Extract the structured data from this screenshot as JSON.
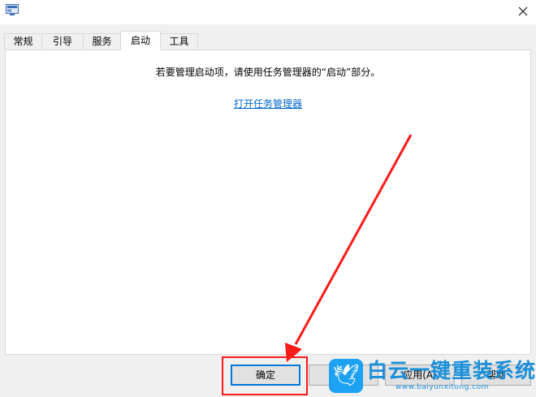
{
  "dialog": {
    "tabs": [
      {
        "label": "常规"
      },
      {
        "label": "引导"
      },
      {
        "label": "服务"
      },
      {
        "label": "启动"
      },
      {
        "label": "工具"
      }
    ],
    "active_tab": "启动",
    "info_text": "若要管理启动项，请使用任务管理器的“启动”部分。",
    "link_text": "打开任务管理器",
    "buttons": {
      "ok": "确定",
      "apply": "应用(A)",
      "help": "帮助"
    }
  },
  "overlay": {
    "highlight_color": "#ff1a1a"
  },
  "watermark": {
    "title": "白云一键重装系统",
    "url": "www.baiyunxitong.com"
  }
}
